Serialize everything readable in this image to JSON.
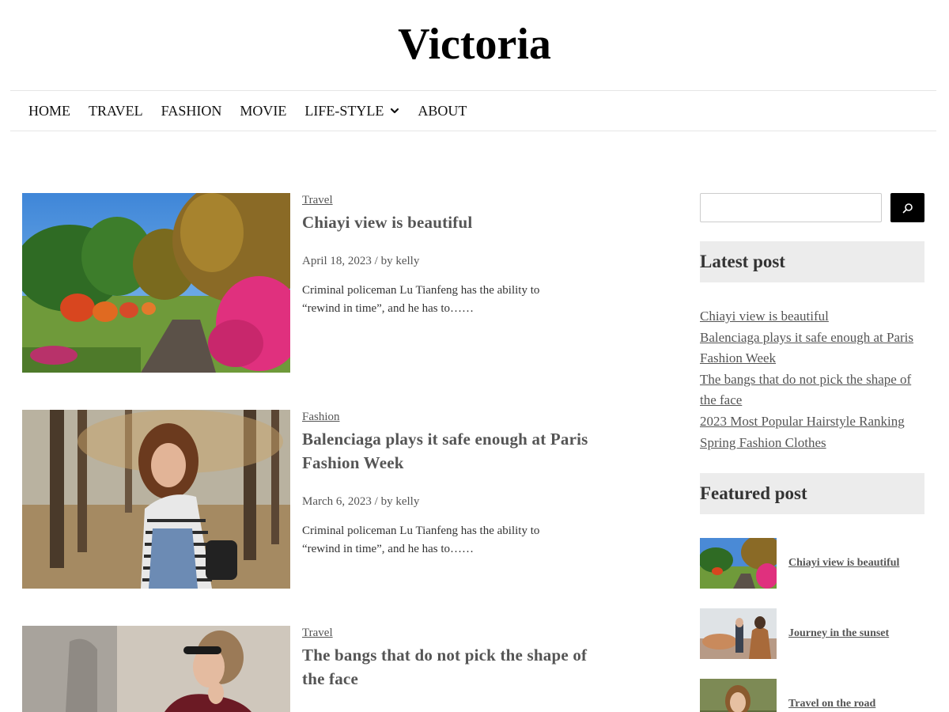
{
  "site": {
    "title": "Victoria"
  },
  "nav": {
    "items": [
      "HOME",
      "TRAVEL",
      "FASHION",
      "MOVIE",
      "LIFE-STYLE",
      "ABOUT"
    ]
  },
  "posts": [
    {
      "category": "Travel",
      "title": "Chiayi view is beautiful",
      "date": "April 18, 2023",
      "author_prefix": "/ by",
      "author": "kelly",
      "excerpt": "Criminal policeman Lu Tianfeng has the ability to “rewind in time”, and he has to……"
    },
    {
      "category": "Fashion",
      "title": "Balenciaga plays it safe enough at Paris Fashion Week",
      "date": "March 6, 2023",
      "author_prefix": "/ by",
      "author": "kelly",
      "excerpt": "Criminal policeman Lu Tianfeng has the ability to “rewind in time”, and he has to……"
    },
    {
      "category": "Travel",
      "title": "The bangs that do not pick the shape of the face"
    }
  ],
  "sidebar": {
    "search": {
      "placeholder": "",
      "button_icon": "search-icon"
    },
    "latest": {
      "title": "Latest post",
      "items": [
        "Chiayi view is beautiful",
        "Balenciaga plays it safe enough at Paris Fashion Week",
        "The bangs that do not pick the shape of the face",
        "2023 Most Popular Hairstyle Ranking",
        "Spring Fashion Clothes"
      ]
    },
    "featured": {
      "title": "Featured post",
      "items": [
        "Chiayi view is beautiful",
        "Journey in the sunset",
        "Travel on the road"
      ]
    }
  },
  "colors": {
    "accent": "#000000",
    "widget_bg": "#ececec",
    "text": "#555555"
  }
}
